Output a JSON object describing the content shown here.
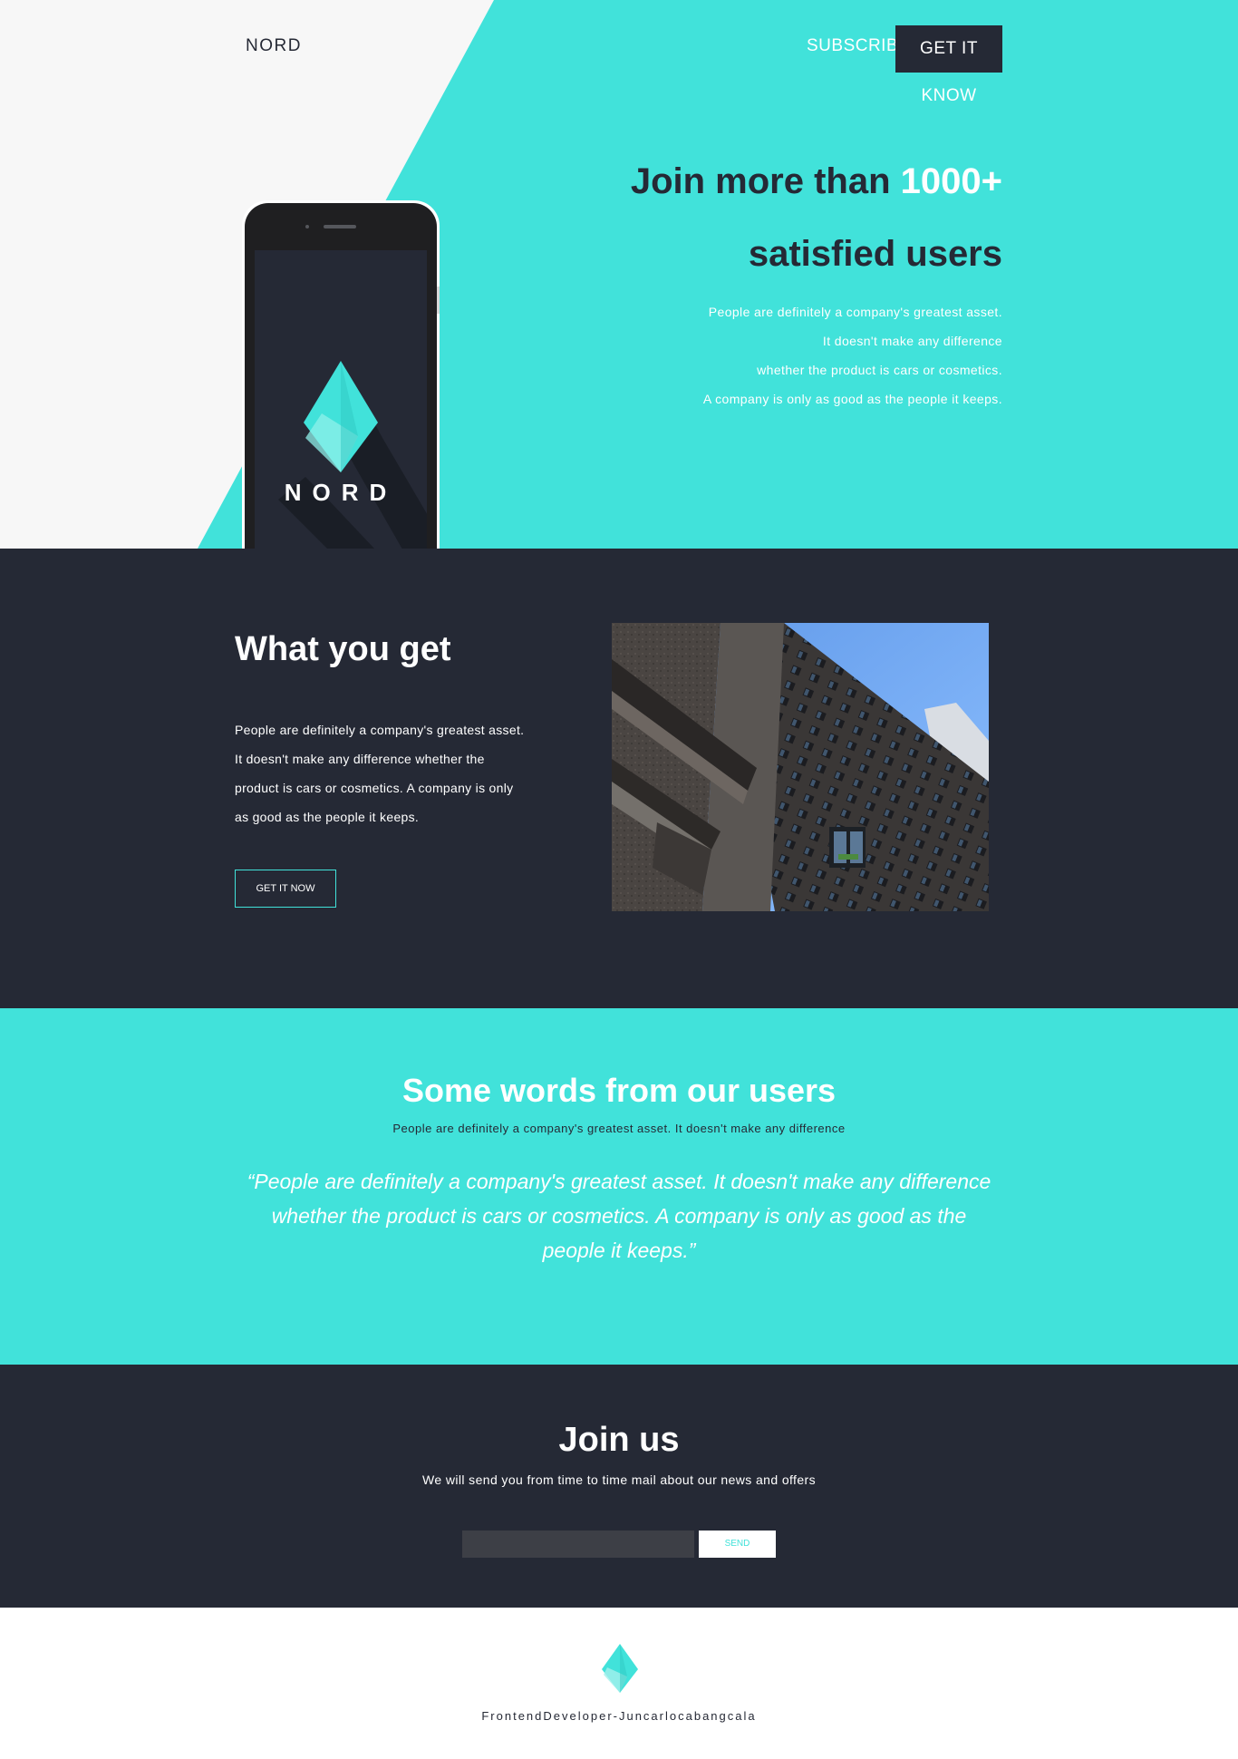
{
  "nav": {
    "logo": "NORD",
    "subscribe": "SUBSCRIBE",
    "cta": "GET IT KNOW"
  },
  "hero": {
    "title_prefix": "Join more than ",
    "title_accent": "1000+",
    "title_line2": "satisfied users",
    "body": [
      "People are definitely a company's greatest asset.",
      "It doesn't make any difference",
      "whether the product is cars or cosmetics.",
      "A company is only as good as the people it keeps."
    ],
    "phone_app_name": "NORD"
  },
  "what_you_get": {
    "title": "What you get",
    "body": "People are definitely a company's greatest asset. It doesn't make any difference whether the product is cars or cosmetics. A company is only as good as the people it keeps.",
    "button": "GET IT NOW"
  },
  "testimonial": {
    "title": "Some words from our users",
    "subtitle": "People are definitely a company's greatest asset. It doesn't make any difference",
    "quote": "“People are definitely a company's greatest asset. It doesn't make any difference whether the product is cars or cosmetics. A company is only as good as the people it keeps.”"
  },
  "join": {
    "title": "Join us",
    "subtitle": "We will send you from time to time mail about our news and offers",
    "email_placeholder": "",
    "send": "SEND"
  },
  "footer": {
    "credit": "FrontendDeveloper-Juncarlocabangcala"
  },
  "colors": {
    "accent": "#41e2da",
    "dark": "#252935",
    "light": "#f7f7f7"
  }
}
